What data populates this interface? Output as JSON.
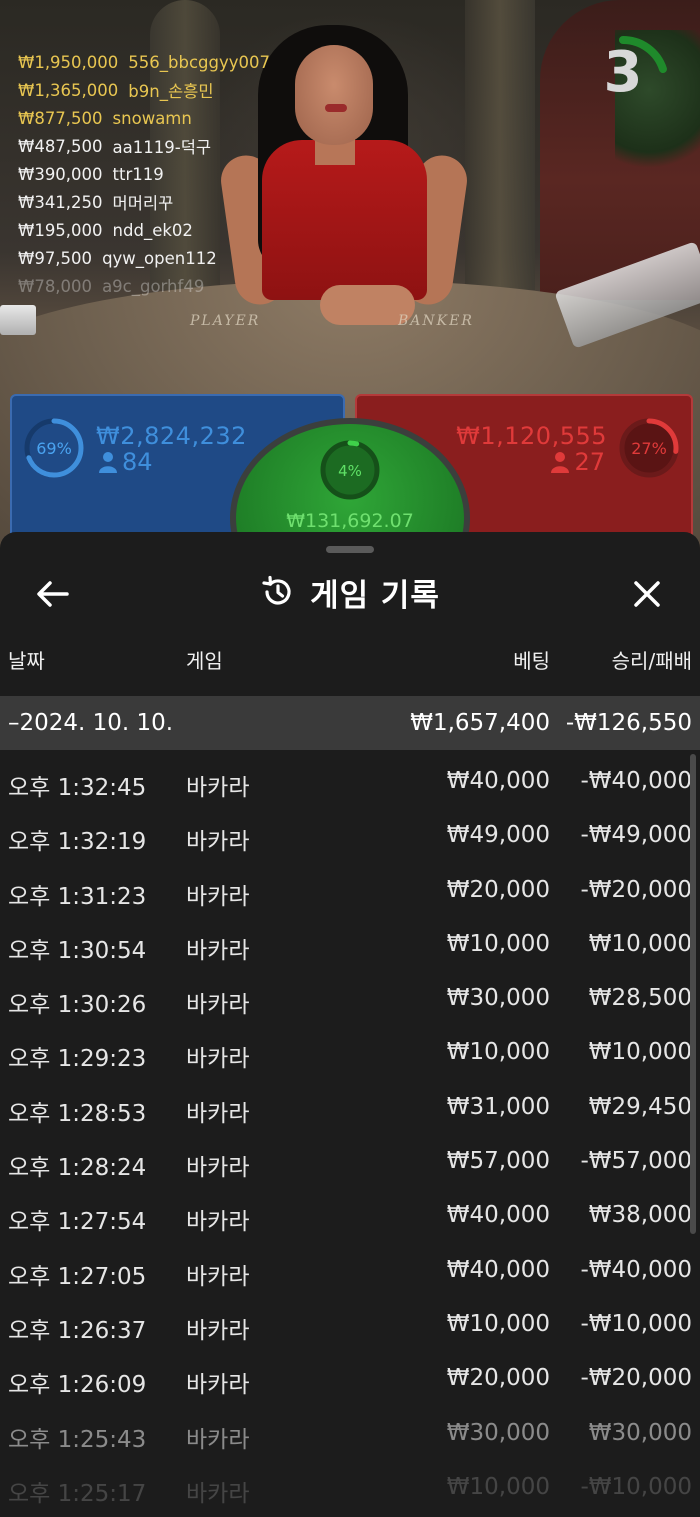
{
  "leaderboard": [
    {
      "amount": "₩1,950,000",
      "name": "556_bbcggyy007",
      "style": "gold"
    },
    {
      "amount": "₩1,365,000",
      "name": "b9n_손흥민",
      "style": "gold"
    },
    {
      "amount": "₩877,500",
      "name": "snowamn",
      "style": "gold"
    },
    {
      "amount": "₩487,500",
      "name": "aa1119-덕구",
      "style": "white"
    },
    {
      "amount": "₩390,000",
      "name": "ttr119",
      "style": "white"
    },
    {
      "amount": "₩341,250",
      "name": "머머리꾸",
      "style": "white"
    },
    {
      "amount": "₩195,000",
      "name": "ndd_ek02",
      "style": "white"
    },
    {
      "amount": "₩97,500",
      "name": "qyw_open112",
      "style": "white"
    },
    {
      "amount": "₩78,000",
      "name": "a9c_gorhf49",
      "style": "fade"
    }
  ],
  "countdown": {
    "value": "3",
    "progress": 0.2
  },
  "table": {
    "player_label": "PLAYER",
    "banker_label": "BANKER"
  },
  "bets": {
    "player": {
      "percent_label": "69%",
      "percent": 0.69,
      "amount": "₩2,824,232",
      "count": "84",
      "color": "#3f8fdc"
    },
    "banker": {
      "percent_label": "27%",
      "percent": 0.27,
      "amount": "₩1,120,555",
      "count": "27",
      "color": "#e03a3a"
    },
    "tie": {
      "percent_label": "4%",
      "percent": 0.04,
      "amount": "₩131,692.07",
      "color": "#3fd14a"
    }
  },
  "history": {
    "title": "게임 기록",
    "columns": {
      "date": "날짜",
      "game": "게임",
      "bet": "베팅",
      "result": "승리/패배"
    },
    "day": {
      "date": "–2024. 10. 10.",
      "bet": "₩1,657,400",
      "result": "-₩126,550"
    },
    "rows": [
      {
        "time": "오후 1:32:45",
        "game": "바카라",
        "bet": "₩40,000",
        "result": "-₩40,000"
      },
      {
        "time": "오후 1:32:19",
        "game": "바카라",
        "bet": "₩49,000",
        "result": "-₩49,000"
      },
      {
        "time": "오후 1:31:23",
        "game": "바카라",
        "bet": "₩20,000",
        "result": "-₩20,000"
      },
      {
        "time": "오후 1:30:54",
        "game": "바카라",
        "bet": "₩10,000",
        "result": "₩10,000"
      },
      {
        "time": "오후 1:30:26",
        "game": "바카라",
        "bet": "₩30,000",
        "result": "₩28,500"
      },
      {
        "time": "오후 1:29:23",
        "game": "바카라",
        "bet": "₩10,000",
        "result": "₩10,000"
      },
      {
        "time": "오후 1:28:53",
        "game": "바카라",
        "bet": "₩31,000",
        "result": "₩29,450"
      },
      {
        "time": "오후 1:28:24",
        "game": "바카라",
        "bet": "₩57,000",
        "result": "-₩57,000"
      },
      {
        "time": "오후 1:27:54",
        "game": "바카라",
        "bet": "₩40,000",
        "result": "₩38,000"
      },
      {
        "time": "오후 1:27:05",
        "game": "바카라",
        "bet": "₩40,000",
        "result": "-₩40,000"
      },
      {
        "time": "오후 1:26:37",
        "game": "바카라",
        "bet": "₩10,000",
        "result": "-₩10,000"
      },
      {
        "time": "오후 1:26:09",
        "game": "바카라",
        "bet": "₩20,000",
        "result": "-₩20,000"
      },
      {
        "time": "오후 1:25:43",
        "game": "바카라",
        "bet": "₩30,000",
        "result": "₩30,000"
      },
      {
        "time": "오후 1:25:17",
        "game": "바카라",
        "bet": "₩10,000",
        "result": "-₩10,000"
      }
    ]
  },
  "icons": {
    "back": "arrow-left-icon",
    "history": "history-clock-icon",
    "close": "close-icon",
    "person": "person-icon"
  }
}
